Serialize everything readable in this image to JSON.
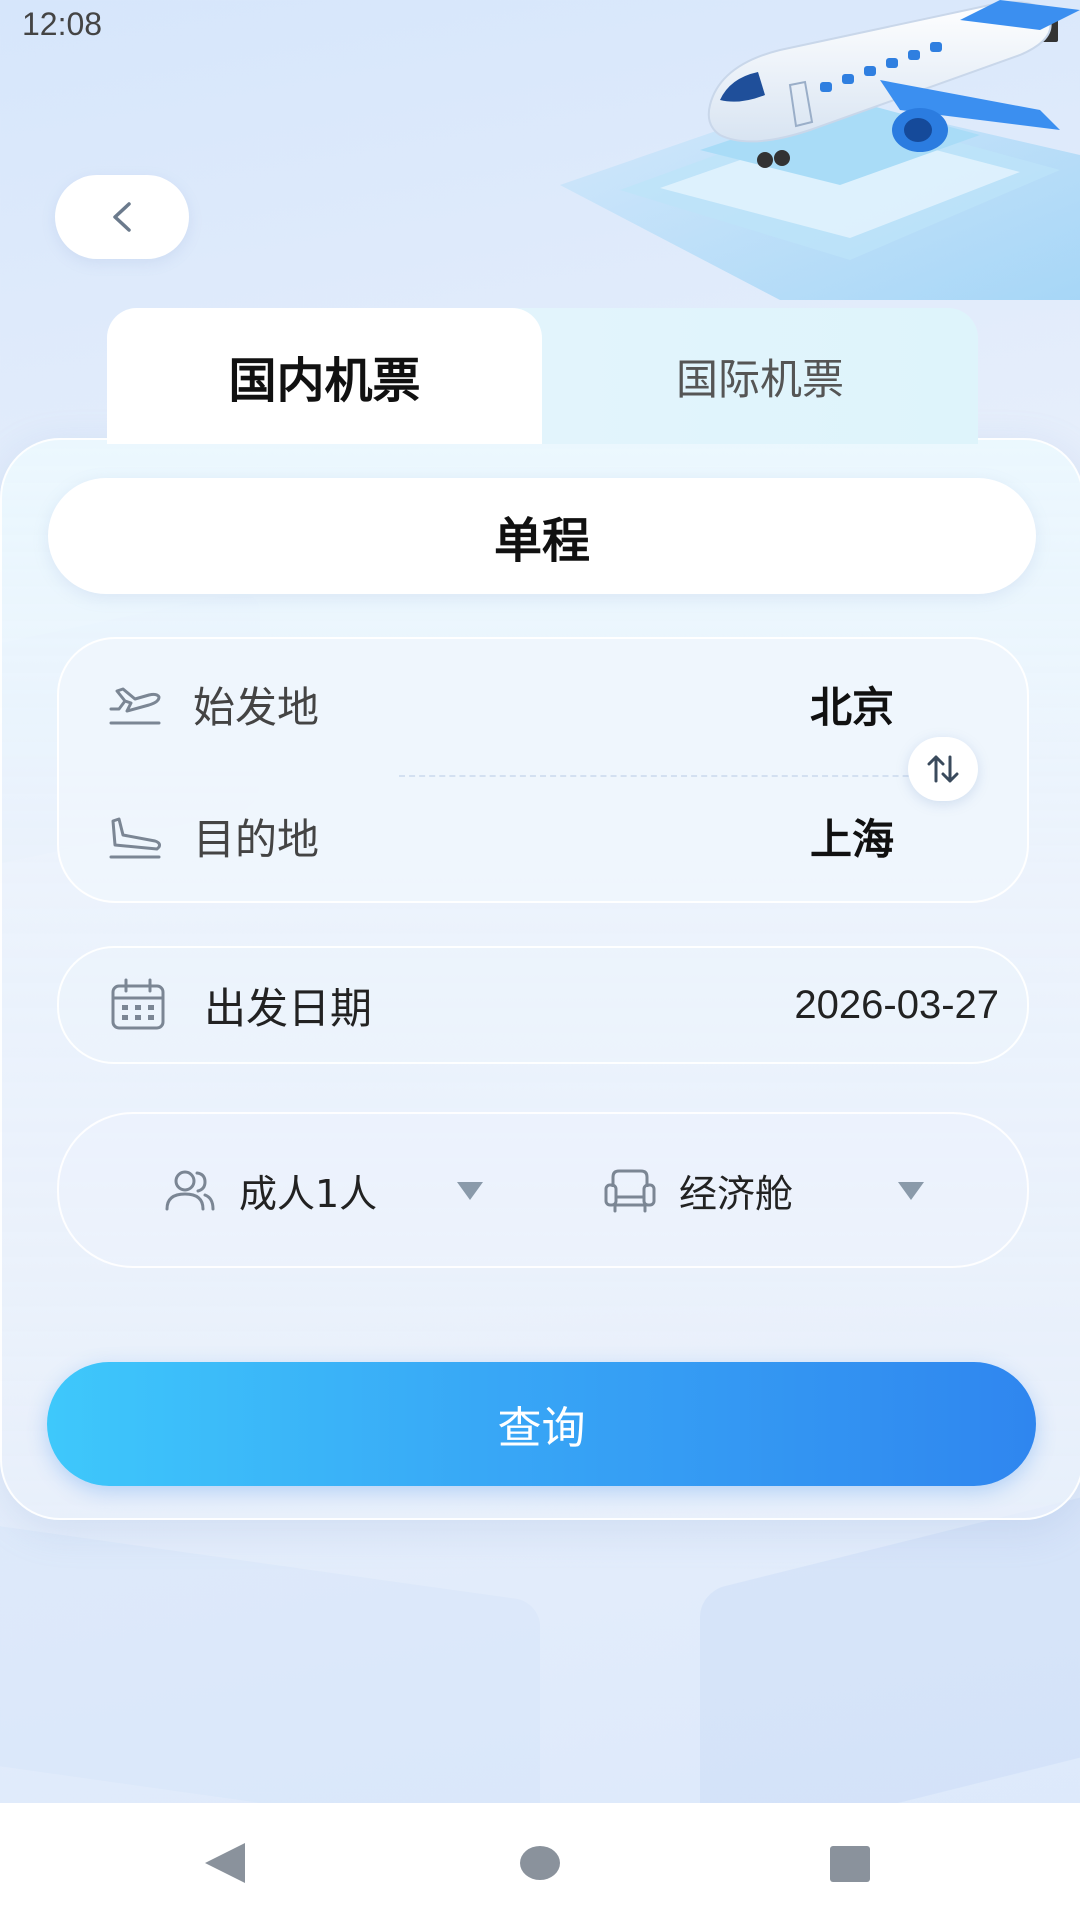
{
  "status_bar": {
    "time": "12:08"
  },
  "tabs": [
    {
      "label": "国内机票",
      "active": true
    },
    {
      "label": "国际机票",
      "active": false
    }
  ],
  "trip_type": "单程",
  "route": {
    "origin_label": "始发地",
    "origin_value": "北京",
    "destination_label": "目的地",
    "destination_value": "上海"
  },
  "date": {
    "label": "出发日期",
    "value": "2026-03-27"
  },
  "passengers": {
    "value": "成人1人"
  },
  "cabin": {
    "value": "经济舱"
  },
  "search_label": "查询",
  "colors": {
    "accent_start": "#3ec8fb",
    "accent_end": "#2f86ef",
    "icon_gray": "#7b8694"
  }
}
